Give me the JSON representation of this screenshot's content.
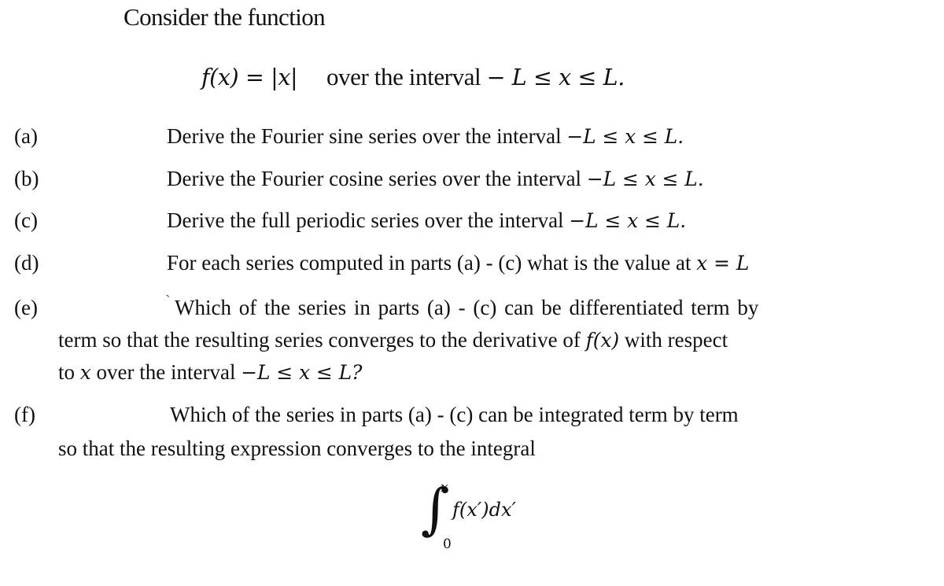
{
  "intro": "Consider the function",
  "function_line": {
    "definition": "f(x) = |x|",
    "text": "over the interval",
    "interval": "− L ≤ x ≤ L."
  },
  "parts": [
    {
      "label": "(a)",
      "text": "Derive the Fourier sine series over the interval",
      "math": "−L ≤ x ≤ L."
    },
    {
      "label": "(b)",
      "text": "Derive the Fourier cosine series over the interval",
      "math": "−L ≤ x ≤ L."
    },
    {
      "label": "(c)",
      "text": "Derive the full periodic series over the interval",
      "math": "−L ≤ x ≤ L."
    },
    {
      "label": "(d)",
      "text": "For each series computed in parts (a) - (c) what is the value at",
      "math": "x = L"
    }
  ],
  "part_e": {
    "label": "(e)",
    "tick": "`",
    "line1": "Which of the series in parts (a) - (c) can be differentiated term by",
    "line2_pre": "term so that the resulting series converges to the derivative of",
    "line2_math": "f(x)",
    "line2_post": "with respect",
    "line3_pre": "to",
    "line3_math1": "x",
    "line3_mid": "over the interval",
    "line3_math2": "−L ≤ x ≤ L?"
  },
  "part_f": {
    "label": "(f)",
    "line1": "Which of the series in parts (a) - (c) can be integrated term by term",
    "line2": "so that the resulting expression converges to the integral"
  },
  "integral": {
    "sign": "∫",
    "upper": "x",
    "lower": "0",
    "integrand": "f(x′)dx′"
  }
}
